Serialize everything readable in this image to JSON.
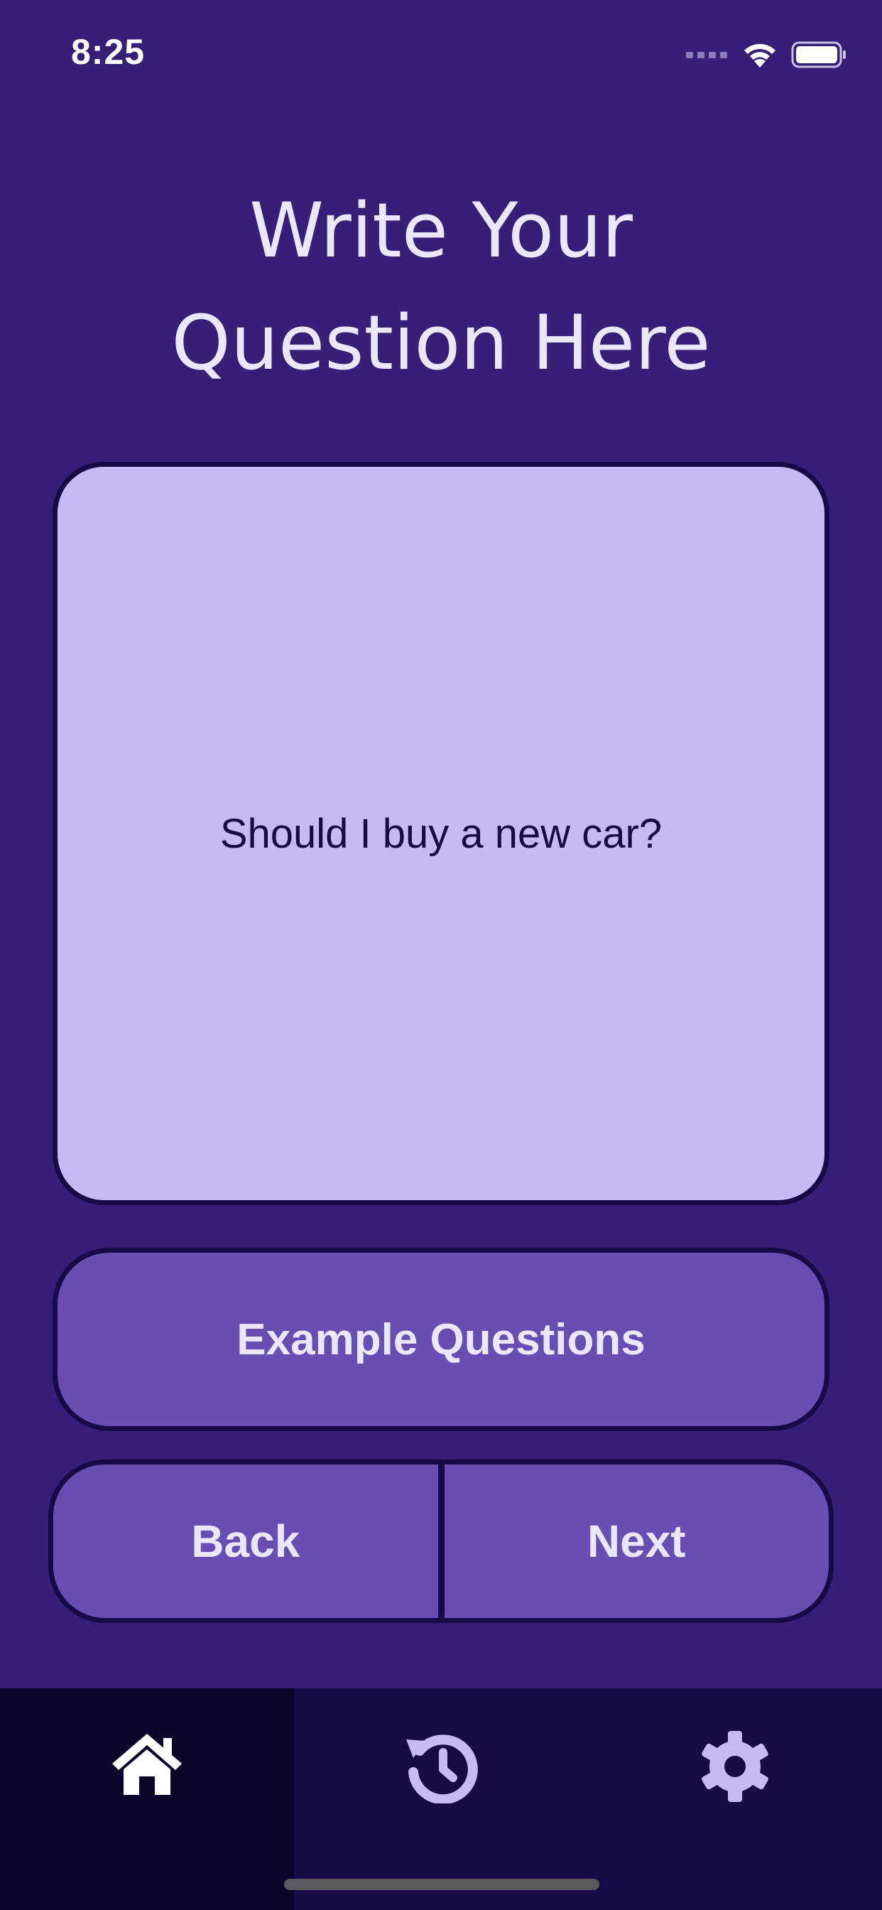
{
  "status_bar": {
    "time": "8:25"
  },
  "page": {
    "title_line1": "Write Your",
    "title_line2": "Question Here"
  },
  "question": {
    "text": "Should I buy a new car?"
  },
  "buttons": {
    "example_questions": "Example Questions",
    "back": "Back",
    "next": "Next"
  },
  "tabbar": {
    "tabs": [
      {
        "icon": "home-icon",
        "active": true
      },
      {
        "icon": "history-icon",
        "active": false
      },
      {
        "icon": "gear-icon",
        "active": false
      }
    ]
  },
  "colors": {
    "background": "#351f77",
    "card": "#c8b8f6",
    "button": "#664eb2",
    "outline": "#170a46",
    "tabbar": "#170a46",
    "tab_active": "#0c0429",
    "icon_active": "#ffffff",
    "icon_inactive": "#c8b8f6"
  }
}
